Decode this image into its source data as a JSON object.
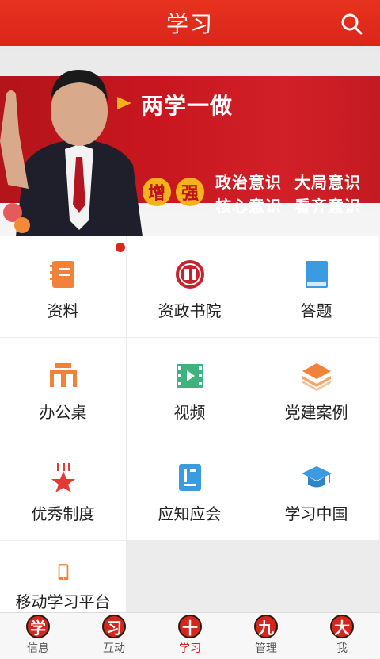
{
  "header": {
    "title": "学习",
    "search_icon": "search-icon"
  },
  "banner": {
    "headline": "两学一做",
    "badge_left": "增",
    "badge_right": "强",
    "slogans": [
      "政治意识",
      "大局意识",
      "核心意识",
      "看齐意识"
    ]
  },
  "grid": {
    "items": [
      {
        "label": "资料",
        "icon": "notebook-icon",
        "color": "#f2823a",
        "badge": true
      },
      {
        "label": "资政书院",
        "icon": "seal-icon",
        "color": "#c8232c"
      },
      {
        "label": "答题",
        "icon": "book-icon",
        "color": "#3b9be0"
      },
      {
        "label": "办公桌",
        "icon": "desk-icon",
        "color": "#f2823a"
      },
      {
        "label": "视频",
        "icon": "film-icon",
        "color": "#3fb27f"
      },
      {
        "label": "党建案例",
        "icon": "layers-icon",
        "color": "#f2823a"
      },
      {
        "label": "优秀制度",
        "icon": "star-award-icon",
        "color": "#e53935"
      },
      {
        "label": "应知应会",
        "icon": "document-icon",
        "color": "#3b9be0"
      },
      {
        "label": "学习中国",
        "icon": "graduation-cap-icon",
        "color": "#3b9be0"
      },
      {
        "label": "移动学习平台",
        "icon": "mobile-phone-icon",
        "color": "#f2823a"
      }
    ]
  },
  "tabbar": {
    "tabs": [
      {
        "glyph": "学",
        "label": "信息"
      },
      {
        "glyph": "习",
        "label": "互动"
      },
      {
        "glyph": "十",
        "label": "学习",
        "active": true
      },
      {
        "glyph": "九",
        "label": "管理"
      },
      {
        "glyph": "大",
        "label": "我"
      }
    ]
  },
  "colors": {
    "primary": "#d9261a",
    "accent_gold": "#f2b31b"
  }
}
